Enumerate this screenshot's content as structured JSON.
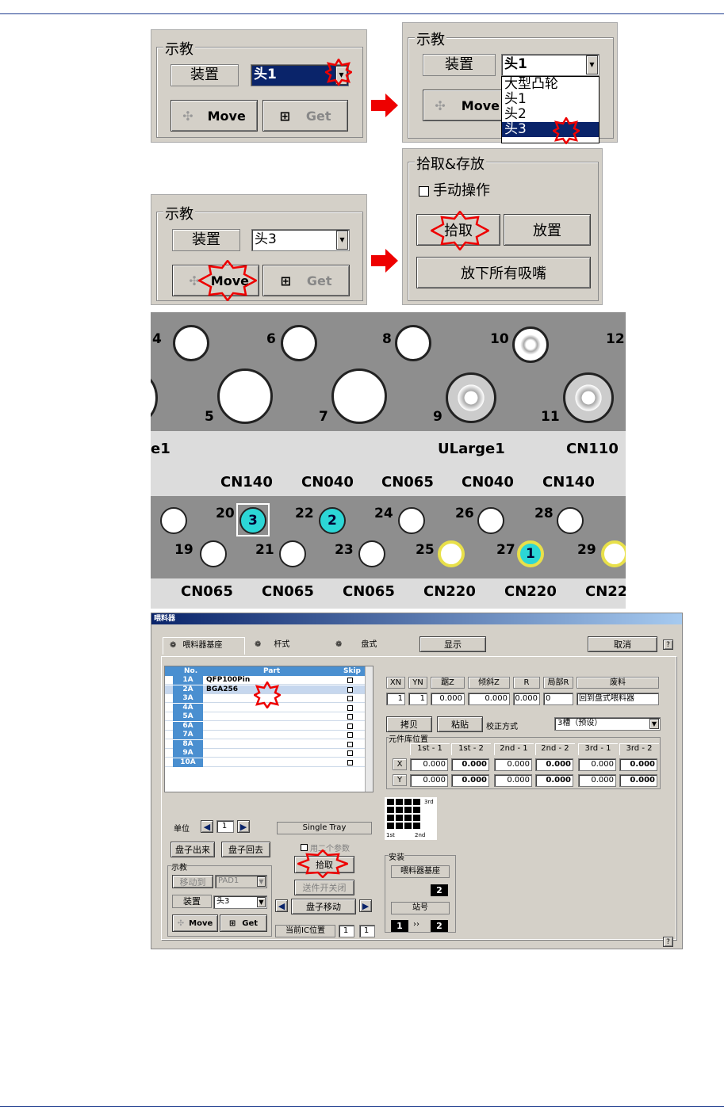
{
  "p1": {
    "group": "示教",
    "device_label": "装置",
    "device_value": "头1",
    "move": "Move",
    "get": "Get"
  },
  "p2": {
    "group": "示教",
    "device_label": "装置",
    "device_value": "头1",
    "move": "Move",
    "options": [
      "大型凸轮",
      "头1",
      "头2",
      "头3"
    ]
  },
  "p3": {
    "group": "示教",
    "device_label": "装置",
    "device_value": "头3",
    "move": "Move",
    "get": "Get"
  },
  "p4": {
    "group": "拾取&存放",
    "manual": "手动操作",
    "pick": "拾取",
    "place": "放置",
    "drop_all": "放下所有吸嘴"
  },
  "photo": {
    "top_numbers": [
      "4",
      "6",
      "8",
      "10",
      "12",
      "5",
      "7",
      "9",
      "11"
    ],
    "top_labels": [
      "e1",
      "ULarge1",
      "CN110"
    ],
    "mid_labels": [
      "CN140",
      "CN040",
      "CN065",
      "CN040",
      "CN140"
    ],
    "strip_numbers": [
      "20",
      "22",
      "24",
      "26",
      "28",
      "19",
      "21",
      "23",
      "25",
      "27",
      "29"
    ],
    "bottom_labels": [
      "CN065",
      "CN065",
      "CN065",
      "CN220",
      "CN220",
      "CN22"
    ],
    "nozzle_marks": [
      "3",
      "2",
      "1"
    ]
  },
  "dlg": {
    "title": "喂料器",
    "tabs": [
      "喂料器基座",
      "杆式",
      "盘式"
    ],
    "show": "显示",
    "cancel": "取消",
    "help": "?",
    "table_headers": [
      "No.",
      "Part",
      "Skip"
    ],
    "rows": [
      {
        "no": "1A",
        "part": "QFP100Pin"
      },
      {
        "no": "2A",
        "part": "BGA256"
      },
      {
        "no": "3A",
        "part": ""
      },
      {
        "no": "4A",
        "part": ""
      },
      {
        "no": "5A",
        "part": ""
      },
      {
        "no": "6A",
        "part": ""
      },
      {
        "no": "7A",
        "part": ""
      },
      {
        "no": "8A",
        "part": ""
      },
      {
        "no": "9A",
        "part": ""
      },
      {
        "no": "10A",
        "part": ""
      }
    ],
    "param_headers": [
      "XN",
      "YN",
      "踞Z",
      "倾斜Z",
      "R",
      "局部R",
      "废料"
    ],
    "param_values": [
      "1",
      "1",
      "0.000",
      "0.000",
      "0.000",
      "0",
      "回到盘式喂料器"
    ],
    "copy": "拷贝",
    "paste": "粘贴",
    "calib": "校正方式",
    "calib_value": "3槽（预设）",
    "lib_group": "元件库位置",
    "lib_headers": [
      "1st - 1",
      "1st - 2",
      "2nd - 1",
      "2nd - 2",
      "3rd - 1",
      "3rd - 2"
    ],
    "lib_rows": [
      {
        "axis": "X",
        "vals": [
          "0.000",
          "0.000",
          "0.000",
          "0.000",
          "0.000",
          "0.000"
        ]
      },
      {
        "axis": "Y",
        "vals": [
          "0.000",
          "0.000",
          "0.000",
          "0.000",
          "0.000",
          "0.000"
        ]
      }
    ],
    "grid_labels": [
      "3rd",
      "1st",
      "2nd"
    ],
    "unit": "单位",
    "unit_value": "1",
    "single_tray": "Single Tray",
    "tray_out": "盘子出来",
    "tray_back": "盘子回去",
    "two_more": "用二个参数",
    "teach": "示教",
    "move_to": "移动到",
    "pad": "PAD1",
    "device": "装置",
    "device_value": "头3",
    "move": "Move",
    "get": "Get",
    "pick": "拾取",
    "clamp": "送件开关闭",
    "tray_move": "盘子移动",
    "current_ic": "当前IC位置",
    "ic1": "1",
    "ic2": "1",
    "install": "安装",
    "feeder_base": "喂料器基座",
    "base_num": "2",
    "station": "站号",
    "st_from": "1",
    "st_arrow": "››",
    "st_to": "2"
  }
}
